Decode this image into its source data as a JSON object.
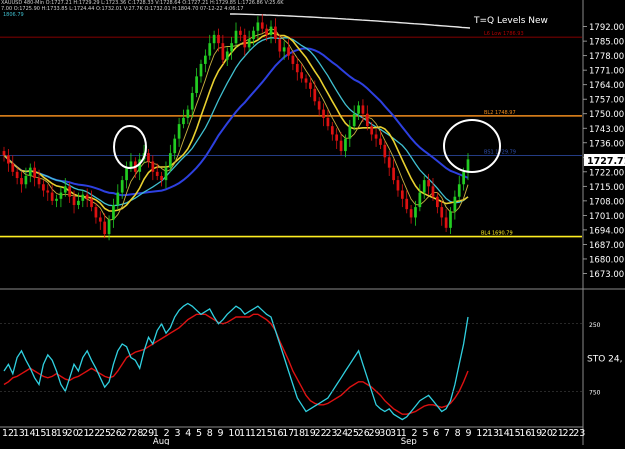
{
  "header": {
    "line1": "XAUUSD 480-Min O:1727.21 H:1729.29 L:1723.36 C:1728.33 V:1728.64 O:1727.21 H:1729.85 L:1726.86 V:25.6K",
    "line2": "7.00 O:1725.90 H:1733.85 L:1724.44 O:1732.01 V:27.7K O:1732.01 H:1804.70 07-12-22 4:06:17",
    "indicator_value": "1806.79"
  },
  "title": "T=Q Levels New",
  "colors": {
    "background": "#000000",
    "candle_up": "#22cc22",
    "candle_down": "#dd1111",
    "level_orange": "#f08c1e",
    "level_yellow": "#ffee22",
    "level_red": "#b00000",
    "ma_blue": "#2d40e0",
    "ma_cyan": "#40c0d0",
    "ma_yellow": "#e8d030",
    "ma_white": "#e8e8e8",
    "stoch_cyan": "#30d0e0",
    "stoch_red": "#dd1111"
  },
  "chart_data": [
    {
      "type": "candlestick",
      "ylim": [
        1666,
        1800
      ],
      "y_ticks": [
        "1792.00",
        "1785.00",
        "1778.00",
        "1771.00",
        "1764.00",
        "1757.00",
        "1750.00",
        "1743.00",
        "1736.00",
        "1729.00",
        "1722.00",
        "1715.00",
        "1708.00",
        "1701.00",
        "1694.00",
        "1687.00",
        "1680.00",
        "1673.00"
      ],
      "current_price": "1727.71",
      "levels": [
        {
          "name": "L6 Low",
          "label": "L6 Low 1786.93",
          "value": 1786.93,
          "color": "red"
        },
        {
          "name": "BL2",
          "label": "BL2 1748.97",
          "value": 1748.97,
          "color": "orange"
        },
        {
          "name": "BS1",
          "label": "BS1 1729.79",
          "value": 1729.79,
          "color": "blue"
        },
        {
          "name": "BL4",
          "label": "BL4 1690.79",
          "value": 1690.79,
          "color": "yellow"
        }
      ],
      "series": [
        {
          "name": "close",
          "values": [
            1730,
            1726,
            1722,
            1719,
            1716,
            1720,
            1724,
            1719,
            1716,
            1713,
            1712,
            1708,
            1709,
            1712,
            1715,
            1710,
            1706,
            1708,
            1711,
            1709,
            1705,
            1700,
            1698,
            1692,
            1699,
            1706,
            1712,
            1718,
            1724,
            1727,
            1722,
            1728,
            1731,
            1727,
            1722,
            1720,
            1718,
            1724,
            1731,
            1738,
            1745,
            1748,
            1752,
            1760,
            1768,
            1774,
            1778,
            1784,
            1788,
            1784,
            1776,
            1780,
            1784,
            1790,
            1788,
            1782,
            1786,
            1790,
            1794,
            1791,
            1788,
            1792,
            1786,
            1780,
            1782,
            1778,
            1774,
            1770,
            1767,
            1765,
            1762,
            1756,
            1752,
            1748,
            1744,
            1740,
            1737,
            1732,
            1738,
            1744,
            1750,
            1754,
            1750,
            1744,
            1740,
            1738,
            1735,
            1729,
            1724,
            1718,
            1713,
            1709,
            1704,
            1700,
            1705,
            1712,
            1718,
            1715,
            1710,
            1705,
            1700,
            1695,
            1703,
            1710,
            1716,
            1722,
            1728
          ]
        }
      ]
    },
    {
      "type": "line",
      "name": "STO",
      "label": "STO 24,",
      "ylim": [
        0,
        100
      ],
      "y_ticks": [
        "250",
        "750"
      ],
      "series": [
        {
          "name": "fast",
          "values": [
            40,
            45,
            38,
            50,
            55,
            48,
            42,
            35,
            30,
            45,
            52,
            48,
            40,
            30,
            25,
            35,
            45,
            40,
            50,
            55,
            48,
            42,
            35,
            28,
            32,
            45,
            55,
            60,
            58,
            50,
            48,
            42,
            55,
            65,
            60,
            70,
            75,
            68,
            72,
            80,
            85,
            88,
            90,
            88,
            85,
            82,
            84,
            86,
            80,
            75,
            78,
            82,
            85,
            88,
            86,
            82,
            84,
            86,
            88,
            85,
            82,
            80,
            70,
            60,
            50,
            40,
            30,
            20,
            15,
            10,
            12,
            14,
            16,
            18,
            20,
            25,
            30,
            35,
            40,
            45,
            50,
            55,
            45,
            35,
            25,
            15,
            12,
            10,
            12,
            8,
            6,
            4,
            6,
            10,
            14,
            18,
            20,
            22,
            18,
            14,
            10,
            12,
            18,
            30,
            45,
            60,
            80
          ]
        },
        {
          "name": "slow",
          "values": [
            30,
            32,
            35,
            36,
            38,
            40,
            42,
            40,
            38,
            36,
            35,
            36,
            38,
            36,
            34,
            33,
            35,
            36,
            38,
            40,
            42,
            40,
            38,
            36,
            35,
            36,
            40,
            45,
            50,
            52,
            54,
            55,
            56,
            58,
            60,
            62,
            64,
            66,
            68,
            70,
            72,
            75,
            78,
            80,
            82,
            82,
            82,
            80,
            78,
            76,
            75,
            76,
            78,
            80,
            80,
            80,
            80,
            82,
            82,
            80,
            78,
            75,
            70,
            62,
            55,
            48,
            40,
            34,
            28,
            22,
            18,
            16,
            15,
            15,
            16,
            18,
            20,
            22,
            25,
            28,
            30,
            32,
            32,
            30,
            28,
            25,
            22,
            18,
            15,
            12,
            10,
            8,
            8,
            9,
            10,
            12,
            14,
            15,
            15,
            14,
            13,
            14,
            16,
            20,
            25,
            32,
            40
          ]
        }
      ]
    }
  ],
  "x_axis": {
    "labels": [
      "12",
      "13",
      "14",
      "15",
      "18",
      "19",
      "20",
      "21",
      "22",
      "25",
      "26",
      "27",
      "28",
      "29",
      "1",
      "2",
      "3",
      "4",
      "5",
      "8",
      "9",
      "10",
      "11",
      "12",
      "15",
      "16",
      "17",
      "18",
      "19",
      "22",
      "23",
      "24",
      "25",
      "26",
      "29",
      "30",
      "31",
      "1",
      "2",
      "5",
      "6",
      "7",
      "8",
      "9",
      "12",
      "13",
      "14",
      "15",
      "16",
      "19",
      "20",
      "21",
      "22",
      "23"
    ],
    "months": [
      {
        "label": "Aug",
        "index": 14
      },
      {
        "label": "Sep",
        "index": 37
      }
    ]
  }
}
